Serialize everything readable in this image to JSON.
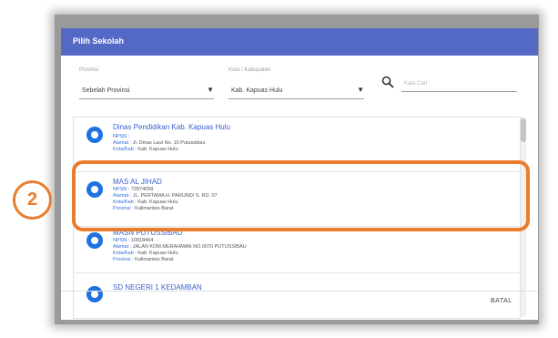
{
  "dialog": {
    "title": "Pilih Sekolah"
  },
  "filters": {
    "provinsi": {
      "label": "Provinsi",
      "value": "Sebelah Provinsi"
    },
    "kabupaten": {
      "label": "Kota / Kabupaten",
      "value": "Kab. Kapuas Hulu"
    },
    "search": {
      "placeholder": "Kata Cari"
    }
  },
  "list": {
    "items": [
      {
        "title": "Dinas Pendidikan Kab. Kapuas Hulu",
        "npsn_label": "NPSN :",
        "npsn": "",
        "alamat_label": "Alamat :",
        "alamat": "Jl. Dinas Laut No. 10 Putussibau",
        "kab_label": "Kota/Kab :",
        "kab": "Kab. Kapuas Hulu",
        "prov_label": "",
        "prov": ""
      },
      {
        "title": "MAS AL JIHAD",
        "npsn_label": "NPSN :",
        "npsn": "72874058",
        "alamat_label": "Alamat :",
        "alamat": "JL. PERTAMA H. PARUNDI S. RD. 07",
        "kab_label": "Kota/Kab :",
        "kab": "Kab. Kapuas Hulu",
        "prov_label": "Provinsi :",
        "prov": "Kalimantan Barat"
      },
      {
        "title": "MASN PUTUSSIBAU",
        "npsn_label": "NPSN :",
        "npsn": "10818464",
        "alamat_label": "Alamat :",
        "alamat": "JALAN KOM.MERAHMAN NO.0070 PUTUSSIBAU",
        "kab_label": "Kota/Kab :",
        "kab": "Kab. Kapuas Hulu",
        "prov_label": "Provinsi :",
        "prov": "Kalimantan Barat"
      },
      {
        "title": "SD NEGERI 1 KEDAMBAN"
      }
    ]
  },
  "footer": {
    "batal_label": "BATAL"
  },
  "callout": {
    "number": "2"
  },
  "colors": {
    "header": "#5468c6",
    "accent": "#1f73e0",
    "callout": "#e97d2d"
  }
}
